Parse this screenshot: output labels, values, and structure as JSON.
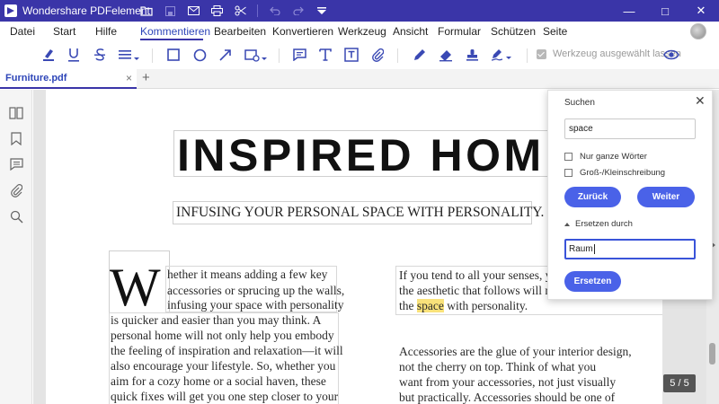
{
  "app": {
    "title": "Wondershare PDFelement"
  },
  "menu": {
    "items": [
      "Datei",
      "Start",
      "Hilfe",
      "Kommentieren",
      "Bearbeiten",
      "Konvertieren",
      "Werkzeug",
      "Ansicht",
      "Formular",
      "Schützen",
      "Seite"
    ],
    "active": "Kommentieren"
  },
  "toolbar": {
    "keep_tool_label": "Werkzeug ausgewählt lassen",
    "tools": [
      "highlight-icon",
      "underline-icon",
      "strikethrough-icon",
      "replace-text-icon",
      "rectangle-icon",
      "oval-icon",
      "arrow-icon",
      "shape-more-icon",
      "note-icon",
      "typewriter-icon",
      "textbox-icon",
      "attachment-icon",
      "pencil-icon",
      "eraser-icon",
      "stamp-icon",
      "signature-icon",
      "eye-icon"
    ]
  },
  "tab": {
    "filename": "Furniture.pdf",
    "close": "×",
    "add": "+"
  },
  "document": {
    "heading": "INSPIRED HOME",
    "subheading": "INFUSING YOUR PERSONAL SPACE WITH PERSONALITY.",
    "dropcap": "W",
    "col1": {
      "l1": "hether it means adding a few key",
      "l2": "accessories or sprucing up the walls,",
      "l3": "infusing your space with personality",
      "l4": "is quicker and easier than you may think. A",
      "l5": "personal home will not only help you embody",
      "l6": "the feeling of inspiration and relaxation—it will",
      "l7": "also encourage your lifestyle. So, whether you",
      "l8": "aim for a cozy home or a social haven, these",
      "l9": "quick fixes will get you one step closer to your"
    },
    "col2": {
      "l1": "If you tend to all your senses, yo",
      "l2": "the aesthetic that follows will na",
      "l3_pre": "the ",
      "l3_hl": "space",
      "l3_post": " with personality.",
      "p2_l1": "Accessories are the glue of your interior design,",
      "p2_l2": "not the cherry on top. Think of what you",
      "p2_l3": "want from your accessories, not just visually",
      "p2_l4": "but practically. Accessories should be one of"
    }
  },
  "find_panel": {
    "title": "Suchen",
    "search_value": "space",
    "whole_words": "Nur ganze Wörter",
    "match_case": "Groß-/Kleinschreibung",
    "prev_label": "Zurück",
    "next_label": "Weiter",
    "replace_section": "Ersetzen durch",
    "replace_value": "Raum",
    "replace_label": "Ersetzen"
  },
  "page_counter": "5 / 5",
  "colors": {
    "titlebar": "#3a35a8",
    "accent": "#4a62e8",
    "highlight": "#f9e27a"
  }
}
